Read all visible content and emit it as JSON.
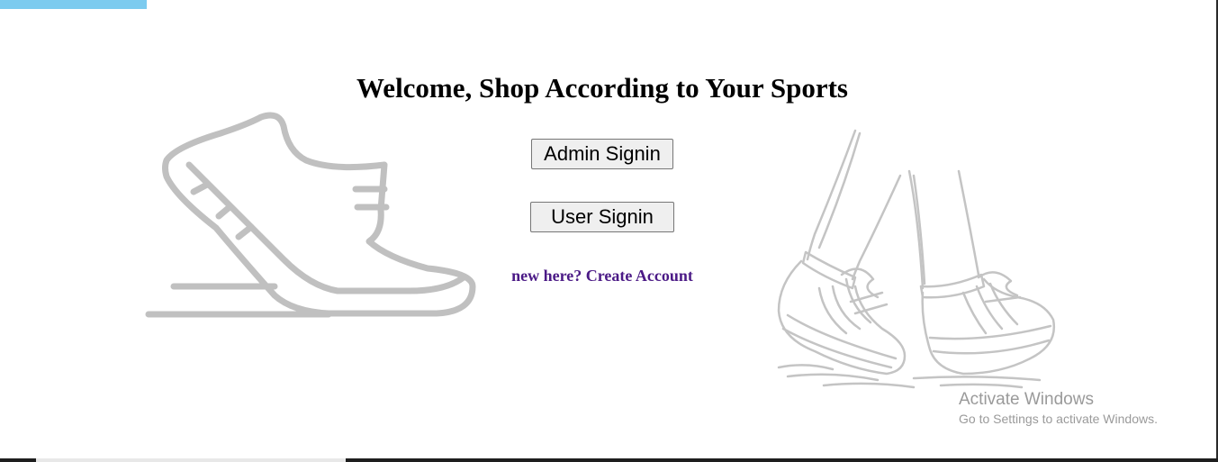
{
  "header": {
    "title": "Welcome, Shop According to Your Sports"
  },
  "actions": {
    "admin_signin_label": "Admin Signin",
    "user_signin_label": "User Signin",
    "create_account_label": "new here? Create Account"
  },
  "illustrations": {
    "left": "running-shoe-icon",
    "right": "walking-legs-sneakers-icon"
  },
  "watermark": {
    "title": "Activate Windows",
    "subtitle": "Go to Settings to activate Windows."
  },
  "colors": {
    "accent_bar": "#7ccbef",
    "link": "#4b1a86",
    "illustration_gray": "#c0c0c0"
  }
}
